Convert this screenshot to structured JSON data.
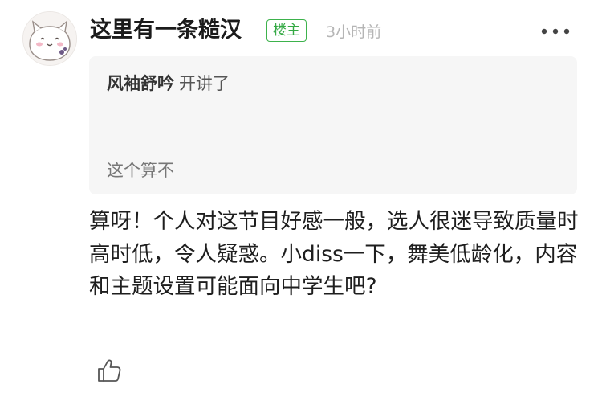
{
  "comment": {
    "avatar_icon": "cartoon-cat-avatar-icon",
    "username": "这里有一条糙汉",
    "badge": "楼主",
    "time": "3小时前",
    "more_icon": "more-dots-icon",
    "quote": {
      "author": "风袖舒吟",
      "title": "开讲了",
      "snippet": "这个算不"
    },
    "body": "算呀！个人对这节目好感一般，选人很迷导致质量时高时低，令人疑惑。小diss一下，舞美低龄化，内容和主题设置可能面向中学生吧?",
    "like_icon": "thumbs-up-icon"
  },
  "colors": {
    "badge_green": "#3db24c",
    "quote_bg": "#f6f6f6",
    "time_gray": "#b5b5b5"
  }
}
